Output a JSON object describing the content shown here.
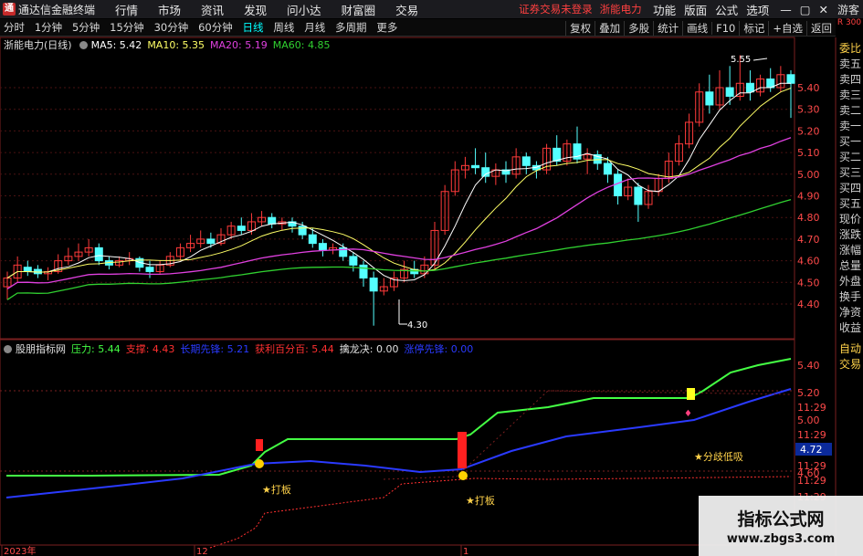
{
  "app": {
    "title": "通达信金融终端"
  },
  "menu": [
    "行情",
    "市场",
    "资讯",
    "发现",
    "问小达",
    "财富圈",
    "交易"
  ],
  "notice": {
    "trade": "证券交易未登录",
    "stock": "浙能电力"
  },
  "right_menu": [
    "功能",
    "版面",
    "公式",
    "选项"
  ],
  "guest": "游客",
  "periods": [
    "分时",
    "1分钟",
    "5分钟",
    "15分钟",
    "30分钟",
    "60分钟",
    "日线",
    "周线",
    "月线",
    "多周期",
    "更多"
  ],
  "active_period": "日线",
  "tools": [
    "复权",
    "叠加",
    "多股",
    "统计",
    "画线",
    "F10",
    "标记",
    "+自选",
    "返回"
  ],
  "r_scale": "R 300",
  "main_legend": {
    "name": "浙能电力(日线)",
    "ma5": "MA5: 5.42",
    "ma10": "MA10: 5.35",
    "ma20": "MA20: 5.19",
    "ma60": "MA60: 4.85"
  },
  "sub_legend": {
    "name": "股朋指标网",
    "pressure": "压力: 5.44",
    "support": "支撑: 4.43",
    "long_line": "长期先锋: 5.21",
    "profit": "获利百分百: 5.44",
    "dragon": "擒龙决: 0.00",
    "short_line": "涨停先锋: 0.00"
  },
  "orderbook": [
    "委比",
    "卖五",
    "卖四",
    "卖三",
    "卖二",
    "卖一",
    "买一",
    "买二",
    "买三",
    "买四",
    "买五",
    "现价",
    "涨跌",
    "涨幅",
    "总量",
    "外盘",
    "换手",
    "净资",
    "收益"
  ],
  "orderbook2": [
    "自动",
    "交易"
  ],
  "price_axis": [
    "5.40",
    "5.30",
    "5.20",
    "5.10",
    "5.00",
    "4.90",
    "4.80",
    "4.70",
    "4.60",
    "4.50",
    "4.40"
  ],
  "sub_axis": [
    "5.40",
    "5.20",
    "11:29",
    "5.00",
    "11:29",
    "4.72",
    "11:29",
    "4.60",
    "11:29",
    "11:29"
  ],
  "high_label": "5.55",
  "low_label": "4.30",
  "annotations": [
    "★打板",
    "★打板",
    "★分歧低吸"
  ],
  "current_box": "4.72",
  "date_labels": [
    "2023年",
    "12",
    "1"
  ],
  "watermark": {
    "title": "指标公式网",
    "url": "www.zbgs3.com"
  },
  "colors": {
    "up": "#ff3a3a",
    "down": "#54ffff",
    "ma5": "#ffffff",
    "ma10": "#ffff66",
    "ma20": "#e040e0",
    "ma60": "#30d030",
    "pressure": "#44ff44",
    "support": "#ff3030",
    "long": "#2a3aff"
  }
}
